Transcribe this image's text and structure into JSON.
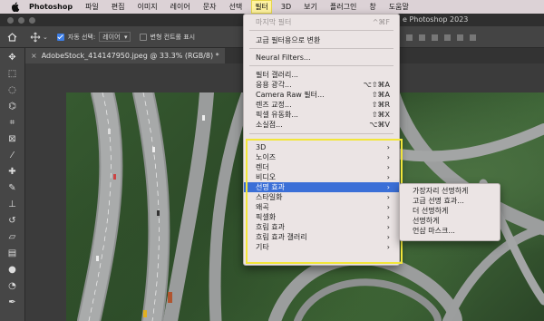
{
  "menubar": {
    "app": "Photoshop",
    "items": [
      "파일",
      "편집",
      "이미지",
      "레이어",
      "문자",
      "선택",
      "필터",
      "3D",
      "보기",
      "플러그인",
      "창",
      "도움말"
    ],
    "active_index": 6
  },
  "window": {
    "title": "e Photoshop 2023"
  },
  "options_bar": {
    "auto_select_label": "자동 선택:",
    "auto_select_value": "레이어",
    "transform_label": "변형 컨트롤 표시"
  },
  "document_tab": {
    "close": "×",
    "title": "AdobeStock_414147950.jpeg @ 33.3% (RGB/8) *"
  },
  "filter_menu": {
    "items": [
      {
        "label": "마지막 필터",
        "shortcut": "^⌘F",
        "disabled": true
      },
      {
        "label": "고급 필터용으로 변환"
      },
      {
        "label": "Neural Filters..."
      },
      {
        "label": "필터 갤러리..."
      },
      {
        "label": "응용 광각...",
        "shortcut": "⌥⇧⌘A"
      },
      {
        "label": "Camera Raw 필터...",
        "shortcut": "⇧⌘A"
      },
      {
        "label": "렌즈 교정...",
        "shortcut": "⇧⌘R"
      },
      {
        "label": "픽셀 유동화...",
        "shortcut": "⇧⌘X"
      },
      {
        "label": "소실점...",
        "shortcut": "⌥⌘V"
      },
      {
        "label": "3D",
        "arrow": "›"
      },
      {
        "label": "노이즈",
        "arrow": "›"
      },
      {
        "label": "렌더",
        "arrow": "›"
      },
      {
        "label": "비디오",
        "arrow": "›"
      },
      {
        "label": "선명 효과",
        "arrow": "›",
        "highlighted": true
      },
      {
        "label": "스타일화",
        "arrow": "›"
      },
      {
        "label": "왜곡",
        "arrow": "›"
      },
      {
        "label": "픽셀화",
        "arrow": "›"
      },
      {
        "label": "흐림 효과",
        "arrow": "›"
      },
      {
        "label": "흐림 효과 갤러리",
        "arrow": "›"
      },
      {
        "label": "기타",
        "arrow": "›"
      }
    ]
  },
  "sharpen_submenu": {
    "items": [
      "가장자리 선명하게",
      "고급 선명 효과...",
      "더 선명하게",
      "선명하게",
      "언샵 마스크..."
    ]
  },
  "colors": {
    "highlight": "#3b6fd7",
    "annotation_box": "#f2e63a",
    "menubar_active": "#fff3a0"
  }
}
